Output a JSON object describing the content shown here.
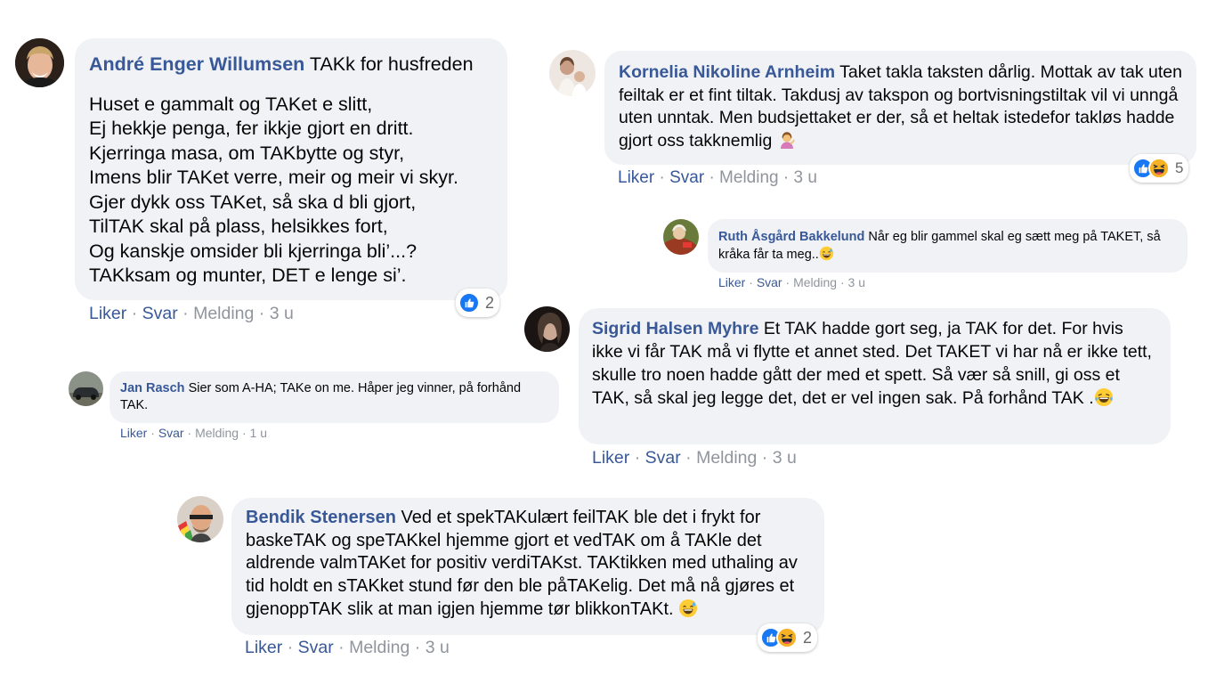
{
  "colors": {
    "name": "#385898",
    "bubble": "#f0f2f5",
    "muted": "#90949c",
    "like_blue": "#1877f2",
    "haha_yellow": "#f7b125"
  },
  "comments": [
    {
      "author": "André Enger Willumsen",
      "title": "TAKk for husfreden",
      "lines": [
        "Huset e gammalt og TAKet e slitt,",
        "Ej hekkje penga, fer ikkje gjort en dritt.",
        "Kjerringa masa, om TAKbytte og styr,",
        "Imens blir TAKet verre, meir og meir vi skyr.",
        "Gjer dykk oss TAKet, så ska d bli gjort,",
        "TilTAK skal på plass, helsikkes fort,",
        "Og kanskje omsider bli kjerringa bli’...?",
        "TAKksam og munter, DET e lenge si’."
      ],
      "reactions": {
        "icons": [
          "like-icon"
        ],
        "count": "2"
      },
      "actions": {
        "like": "Liker",
        "reply": "Svar",
        "message": "Melding",
        "time": "3 u"
      }
    },
    {
      "author": "Jan Rasch",
      "text": "Sier som A-HA; TAKe on me. Håper jeg vinner, på forhånd TAK.",
      "actions": {
        "like": "Liker",
        "reply": "Svar",
        "message": "Melding",
        "time": "1 u"
      }
    },
    {
      "author": "Bendik Stenersen",
      "text": "Ved et spekTAKulært feilTAK ble det i frykt for baskeTAK og speTAKkel hjemme gjort et vedTAK om å TAKle det aldrende valmTAKet for positiv verdiTAKst. TAKtikken med uthaling av tid holdt en sTAKket stund før den ble påTAKelig. Det må nå gjøres et gjenoppTAK slik at man igjen hjemme tør blikkonTAKt.",
      "emoji": "grinning-sweat-emoji",
      "reactions": {
        "icons": [
          "like-icon",
          "haha-icon"
        ],
        "count": "2"
      },
      "actions": {
        "like": "Liker",
        "reply": "Svar",
        "message": "Melding",
        "time": "3 u"
      }
    },
    {
      "author": "Kornelia Nikoline Arnheim",
      "text": "Taket takla taksten dårlig. Mottak av tak uten feiltak er et fint tiltak. Takdusj av takspon og bortvisningstiltak vil vi unngå uten unntak. Men budsjettaket er der, så et heltak istedefor takløs hadde gjort oss takknemlig",
      "emoji": "person-tipping-hand-emoji",
      "reactions": {
        "icons": [
          "like-icon",
          "haha-icon"
        ],
        "count": "5"
      },
      "actions": {
        "like": "Liker",
        "reply": "Svar",
        "message": "Melding",
        "time": "3 u"
      }
    },
    {
      "author": "Ruth Åsgård Bakkelund",
      "text": "Når eg blir gammel skal eg sætt meg på TAKET, så kråka får ta meg..",
      "emoji": "grinning-sweat-emoji",
      "actions": {
        "like": "Liker",
        "reply": "Svar",
        "message": "Melding",
        "time": "3 u"
      }
    },
    {
      "author": "Sigrid Halsen Myhre",
      "text": "Et TAK hadde gort seg, ja TAK for det. For hvis ikke vi får TAK må vi flytte et annet sted. Det TAKET vi har nå er ikke tett, skulle tro noen hadde gått der med et spett. Så vær så snill, gi oss et TAK, så skal jeg legge det, det er vel ingen sak. På forhånd TAK .",
      "emoji": "tears-of-joy-emoji",
      "actions": {
        "like": "Liker",
        "reply": "Svar",
        "message": "Melding",
        "time": "3 u"
      }
    }
  ]
}
